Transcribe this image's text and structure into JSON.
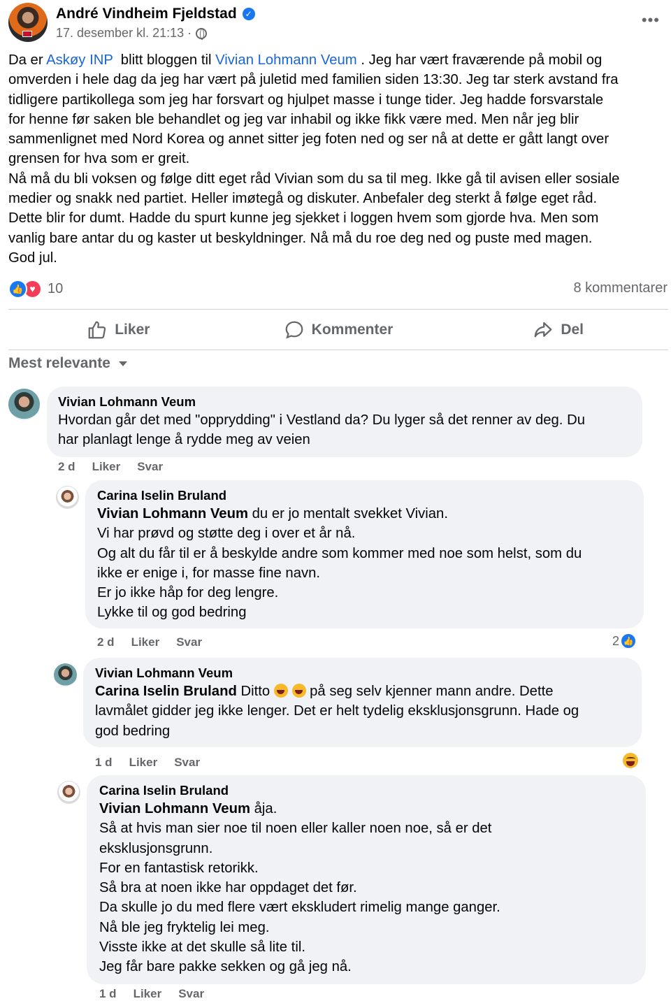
{
  "post": {
    "author": "André Vindheim Fjeldstad",
    "timestamp": "17. desember kl. 21:13 ·",
    "more_label": "•••",
    "body": {
      "l1_pre": "Da er ",
      "l1_link1": "Askøy INP",
      "l1_mid": "  blitt bloggen til ",
      "l1_link2": "Vivian Lohmann Veum",
      "l1_post": " . Jeg har vært fraværende på mobil og",
      "lines": [
        "omverden i hele dag da jeg har vært på juletid med familien siden 13:30. Jeg tar sterk avstand fra",
        "tidligere partikollega som jeg har forsvart og hjulpet masse i tunge tider. Jeg hadde forsvarstale",
        "for henne før saken ble behandlet og jeg var inhabil og ikke fikk være med. Men når jeg blir",
        "sammenlignet med Nord Korea og annet sitter jeg foten ned og ser nå at dette er gått langt over",
        "grensen for hva som er greit.",
        "Nå må du bli voksen og følge ditt eget råd Vivian som du sa til meg. Ikke gå til avisen eller sosiale",
        "medier og snakk ned partiet. Heller imøtegå og diskuter. Anbefaler deg sterkt å følge eget råd.",
        "Dette blir for dumt. Hadde du spurt kunne jeg sjekket i loggen hvem som gjorde hva. Men som",
        "vanlig bare antar du og kaster ut beskyldninger. Nå må du roe deg ned og puste med magen.",
        "God jul."
      ]
    },
    "reaction_count": "10",
    "comment_count": "8 kommentarer"
  },
  "actions": {
    "like": "Liker",
    "comment": "Kommenter",
    "share": "Del"
  },
  "sort_label": "Mest relevante",
  "comments": [
    {
      "name": "Vivian Lohmann Veum",
      "lines": [
        "Hvordan går det med \"opprydding\" i Vestland da? Du lyger så det renner av deg. Du",
        "har planlagt lenge å rydde meg av veien"
      ],
      "time": "2 d",
      "like": "Liker",
      "reply": "Svar"
    },
    {
      "name": "Carina Iselin Bruland",
      "tag": "Vivian Lohmann Veum",
      "first_rest": " du er jo mentalt svekket Vivian.",
      "lines": [
        "Vi har prøvd og støtte deg i over et år nå.",
        "Og alt du får til er å beskylde andre som kommer med noe som helst, som du",
        "ikke er enige i, for masse fine navn.",
        "Er jo ikke håp for deg lengre.",
        "Lykke til og god bedring"
      ],
      "time": "2 d",
      "like": "Liker",
      "reply": "Svar",
      "reaction_count": "2"
    },
    {
      "name": "Vivian Lohmann Veum",
      "tag": "Carina Iselin Bruland",
      "first_a": " Ditto ",
      "first_b": " på seg selv kjenner mann andre. Dette",
      "lines": [
        "lavmålet gidder jeg ikke lenger. Det er helt tydelig eksklusjonsgrunn. Hade og",
        "god bedring"
      ],
      "time": "1 d",
      "like": "Liker",
      "reply": "Svar"
    },
    {
      "name": "Carina Iselin Bruland",
      "tag": "Vivian Lohmann Veum",
      "first_rest": " åja.",
      "lines": [
        "Så at hvis man sier noe til noen eller kaller noen noe, så er det",
        "eksklusjonsgrunn.",
        "For en fantastisk retorikk.",
        "Så bra at noen ikke har oppdaget det før.",
        "Da skulle jo du med flere vært ekskludert rimelig mange ganger.",
        "Nå ble jeg fryktelig lei meg.",
        "Visste ikke at det skulle så lite til.",
        "Jeg får bare pakke sekken og gå jeg nå."
      ],
      "time": "1 d",
      "like": "Liker",
      "reply": "Svar"
    }
  ],
  "colors": {
    "link": "#1a66d9",
    "like_blue": "#1877f2",
    "love_red": "#f33e58",
    "haha_yellow": "#f7b928",
    "bubble_bg": "#f0f2f5",
    "secondary_text": "#65676b"
  },
  "icons": {
    "verified": "verified-badge-icon",
    "privacy": "globe-icon",
    "like": "thumbs-up-icon",
    "comment": "speech-bubble-icon",
    "share": "share-arrow-icon",
    "sort": "caret-down-icon"
  }
}
